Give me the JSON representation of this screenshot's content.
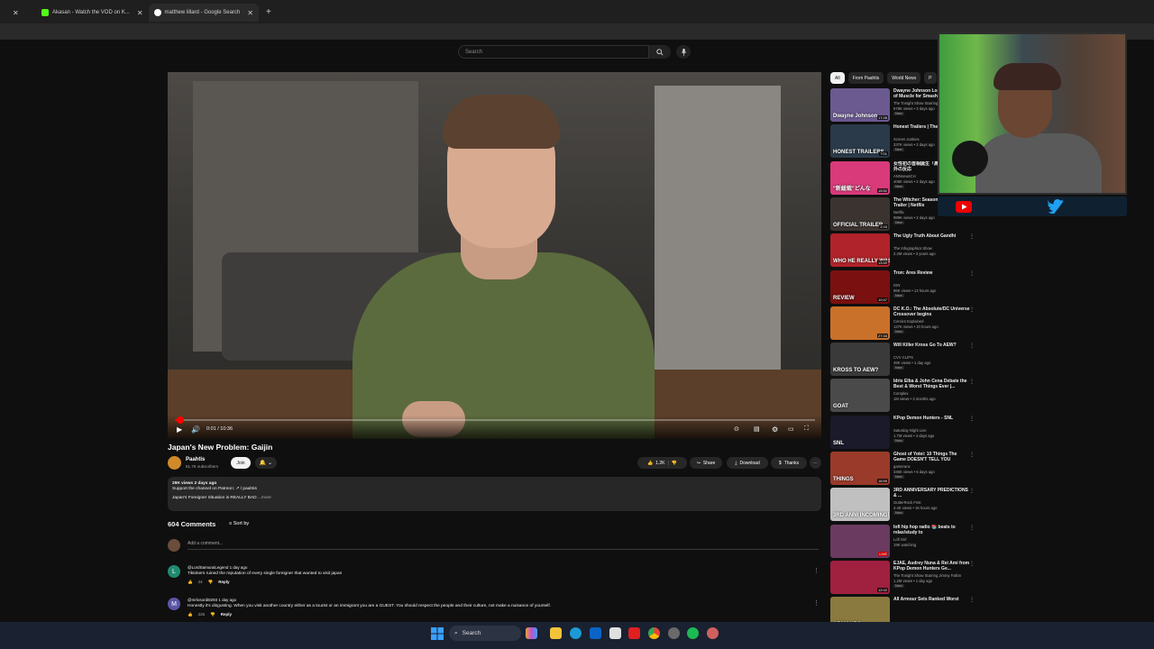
{
  "browser": {
    "tabs": [
      {
        "label": "",
        "color": "#888888"
      },
      {
        "label": "Akasan - Watch the VOD on K...",
        "color": "#53fc18"
      },
      {
        "label": "matthew lillard - Google Search",
        "color": "#4285f4"
      }
    ],
    "new_tab": "+"
  },
  "youtube": {
    "search_placeholder": "Search",
    "video": {
      "title": "Japan's New Problem: Gaijin",
      "timecode": "0:01 / 10:36",
      "progress_fraction": 0.002
    },
    "channel": {
      "name": "Paahtis",
      "subscribers": "51.7K subscribers",
      "join": "Join",
      "bell": "🔔 ⌄"
    },
    "actions": {
      "likes": "1.2K",
      "share": "Share",
      "download": "Download",
      "thanks": "Thanks",
      "more": "⋯"
    },
    "description": {
      "stats": "29K views  2 days ago",
      "line1": "Support the channel on Patreon:  ↗ / paahtis",
      "line2": "Japan's Foreigner Situation is REALLY BAD",
      "more": "...more"
    },
    "comments": {
      "count": "604 Comments",
      "sort_by": "Sort by",
      "add_placeholder": "Add a comment...",
      "items": [
        {
          "initial": "L",
          "avatar_color": "#1f8a70",
          "handle": "@LordSamuraiLegend  1 day ago",
          "text": "Tiktokers ruined the reputation of every single foreigner that wanted to visit japan",
          "likes": "44",
          "reply": "Reply"
        },
        {
          "initial": "M",
          "avatar_color": "#5b55a8",
          "handle": "@mrlosordi8293  1 day ago",
          "text": "Honestly it's disgusting. When you visit another country either as a tourist or an immigrant you are a GUEST. You should respect the people and their culture, not make a nuisance of yourself.",
          "likes": "226",
          "reply": "Reply"
        }
      ]
    },
    "chips": [
      "All",
      "From Paahtis",
      "World News",
      "P"
    ],
    "recommendations": [
      {
        "title": "Dwayne Johnson Lost 60 Pounds of Muscle for Smashing...",
        "channel": "The Tonight Show Starring...",
        "meta": "678K views • 3 days ago",
        "badge": "New",
        "duration": "17:26",
        "thumb": "#6a5a90",
        "label": "Dwayne Johnson"
      },
      {
        "title": "Honest Trailers | The Witcher",
        "channel": "Screen Junkies",
        "meta": "337K views • 3 days ago",
        "badge": "New",
        "duration": "7:01",
        "thumb": "#2a3a4a",
        "label": "HONEST TRAILERS"
      },
      {
        "title": "女性初の首相誕生「高市早苗さん」海外の反応",
        "channel": "ANNnewsCH",
        "meta": "408K views • 2 days ago",
        "badge": "New",
        "duration": "15:52",
        "thumb": "#d83a7a",
        "label": "\"新総裁\"どんな"
      },
      {
        "title": "The Witcher: Season 4 | Official Trailer | Netflix",
        "channel": "Netflix",
        "meta": "989K views • 2 days ago",
        "badge": "New",
        "duration": "2:33",
        "thumb": "#3a3330",
        "label": "OFFICIAL TRAILER"
      },
      {
        "title": "The Ugly Truth About Gandhi",
        "channel": "The Infographics Show",
        "meta": "2.2M views • 3 years ago",
        "badge": "",
        "duration": "13:40",
        "thumb": "#b0232a",
        "label": "WHO HE REALLY WAS"
      },
      {
        "title": "Tron: Ares Review",
        "channel": "IGN",
        "meta": "96K views • 13 hours ago",
        "badge": "New",
        "duration": "10:47",
        "thumb": "#7a1010",
        "label": "REVIEW"
      },
      {
        "title": "DC K.O.: The Absolute/DC Universe Crossover begins",
        "channel": "Comics Explained",
        "meta": "127K views • 10 hours ago",
        "badge": "New",
        "duration": "27:34",
        "thumb": "#c9712a",
        "label": ""
      },
      {
        "title": "Will Killer Kross Go To AEW?",
        "channel": "CVV CLIPS",
        "meta": "49K views • 1 day ago",
        "badge": "New",
        "duration": "",
        "thumb": "#3a3a3a",
        "label": "KROSS TO AEW?"
      },
      {
        "title": "Idris Elba & John Cena Debate the Best & Worst Things Ever |...",
        "channel": "Complex",
        "meta": "1M views • 3 months ago",
        "badge": "",
        "duration": "",
        "thumb": "#4a4a4a",
        "label": "GOAT"
      },
      {
        "title": "KPop Demon Hunters - SNL",
        "channel": "Saturday Night Live",
        "meta": "1.7M views • 4 days ago",
        "badge": "New",
        "duration": "",
        "thumb": "#1a1a2a",
        "label": "SNL"
      },
      {
        "title": "Ghost of Yotei: 10 Things The Game DOESN'T TELL YOU",
        "channel": "gameranx",
        "meta": "346K views • 6 days ago",
        "badge": "New",
        "duration": "16:59",
        "thumb": "#9a3a2a",
        "label": "THINGS"
      },
      {
        "title": "3RD ANNIVERSARY PREDICTIONS & ...",
        "channel": "GutterRock First",
        "meta": "4.4K views • 16 hours ago",
        "badge": "New",
        "duration": "",
        "thumb": "#c0c0c0",
        "label": "3RD ANNI INCOMING!"
      },
      {
        "title": "lofi hip hop radio 📚 beats to relax/study to",
        "channel": "Lofi Girl",
        "meta": "19K watching",
        "badge": "",
        "duration": "LIVE",
        "thumb": "#6a3a60",
        "label": ""
      },
      {
        "title": "EJAE, Audrey Nuna & Rei Ami from KPop Demon Hunters Ge...",
        "channel": "The Tonight Show Starring Jimmy Fallon",
        "meta": "1.2M views • 1 day ago",
        "badge": "New",
        "duration": "12:02",
        "thumb": "#a02040",
        "label": ""
      },
      {
        "title": "All Armour Sets Ranked Worst",
        "channel": "",
        "meta": "",
        "badge": "",
        "duration": "",
        "thumb": "#8a7a40",
        "label": "ARMOURS"
      }
    ]
  },
  "taskbar": {
    "search": "Search"
  }
}
